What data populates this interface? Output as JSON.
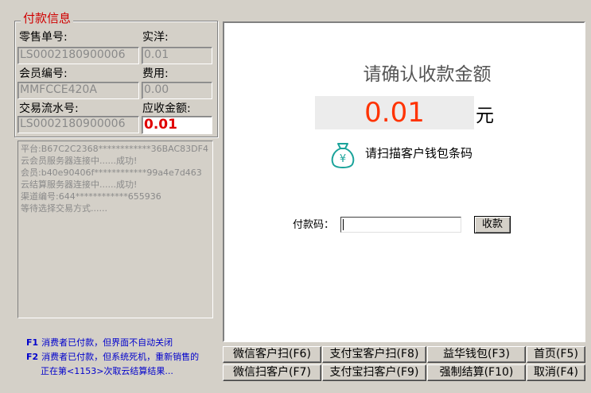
{
  "payment_info": {
    "group_title": "付款信息",
    "retail_no_label": "零售单号:",
    "retail_no_value": "LS0002180900006",
    "actual_label": "实洋:",
    "actual_value": "0.01",
    "member_no_label": "会员编号:",
    "member_no_value": "MMFCCE420A",
    "fee_label": "费用:",
    "fee_value": "0.00",
    "trade_serial_label": "交易流水号:",
    "trade_serial_value": "LS0002180900006",
    "receivable_label": "应收金额:",
    "receivable_value": "0.01"
  },
  "log": [
    "平台:B67C2C2368************36BAC83DF4",
    "云会员服务器连接中......成功!",
    "会员:b40e90406f************99a4e7d463",
    "云结算服务器连接中......成功!",
    "渠道编号:644************655936",
    "等待选择交易方式......"
  ],
  "hints": {
    "f1_key": "F1",
    "f1_text": "消费者已付款，但界面不自动关闭",
    "f2_key": "F2",
    "f2_text": "消费者已付款，但系统死机，重新销售的",
    "f2_status": "正在第<1153>次取云结算结果..."
  },
  "main": {
    "confirm_title": "请确认收款金额",
    "amount": "0.01",
    "unit": "元",
    "scan_text": "请扫描客户钱包条码",
    "pay_code_label": "付款码：",
    "pay_code_value": "",
    "collect_label": "收款"
  },
  "buttons": {
    "wechat_customer_scan": "微信客户扫(F6)",
    "alipay_customer_scan": "支付宝客户扫(F8)",
    "yihua_wallet": "益华钱包(F3)",
    "home": "首页(F5)",
    "wechat_scan_customer": "微信扫客户(F7)",
    "alipay_scan_customer": "支付宝扫客户(F9)",
    "force_settle": "强制结算(F10)",
    "cancel": "取消(F4)"
  },
  "colors": {
    "amount": "#ff3300",
    "group_title": "#d00000",
    "hint": "#0000cc",
    "receivable": "#e00000"
  }
}
